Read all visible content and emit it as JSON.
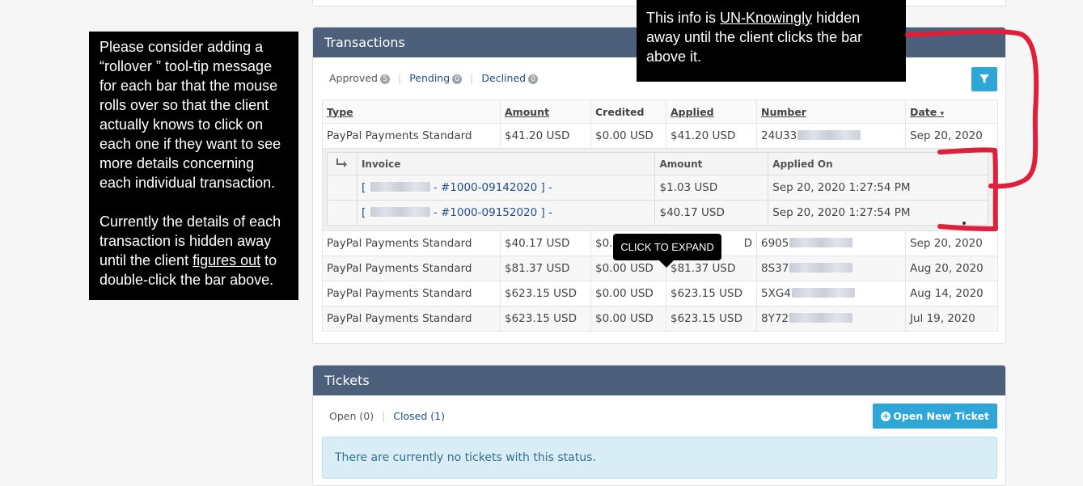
{
  "transactions": {
    "title": "Transactions",
    "filters": [
      {
        "label": "Approved",
        "count": "5"
      },
      {
        "label": "Pending",
        "count": "0"
      },
      {
        "label": "Declined",
        "count": "0"
      }
    ],
    "filter_button_icon": "filter-icon",
    "columns": [
      "Type",
      "Amount",
      "Credited",
      "Applied",
      "Number",
      "Date"
    ],
    "sort_caret": "▾",
    "rows": [
      {
        "type": "PayPal Payments Standard",
        "amount": "$41.20 USD",
        "credited": "$0.00 USD",
        "applied": "$41.20 USD",
        "number": "24U33",
        "date": "Sep 20, 2020"
      },
      {
        "type": "PayPal Payments Standard",
        "amount": "$40.17 USD",
        "credited": "$0.0",
        "applied": "D",
        "number": "6905",
        "date": "Sep 20, 2020"
      },
      {
        "type": "PayPal Payments Standard",
        "amount": "$81.37 USD",
        "credited": "$0.00 USD",
        "applied": "$81.37 USD",
        "number": "8S37",
        "date": "Aug 20, 2020"
      },
      {
        "type": "PayPal Payments Standard",
        "amount": "$623.15 USD",
        "credited": "$0.00 USD",
        "applied": "$623.15 USD",
        "number": "5XG4",
        "date": "Aug 14, 2020"
      },
      {
        "type": "PayPal Payments Standard",
        "amount": "$623.15 USD",
        "credited": "$0.00 USD",
        "applied": "$623.15 USD",
        "number": "8Y72",
        "date": "Jul 19, 2020"
      }
    ],
    "detail": {
      "arrow_icon": "reply-arrow-icon",
      "columns": [
        "Invoice",
        "Amount",
        "Applied On"
      ],
      "rows": [
        {
          "open": "[",
          "invoice": "- #1000-09142020 ] -",
          "amount": "$1.03 USD",
          "applied_on": "Sep 20, 2020 1:27:54 PM"
        },
        {
          "open": "[",
          "invoice": "- #1000-09152020 ] -",
          "amount": "$40.17 USD",
          "applied_on": "Sep 20, 2020 1:27:54 PM"
        }
      ]
    }
  },
  "tickets": {
    "title": "Tickets",
    "filters": [
      {
        "label": "Open (0)"
      },
      {
        "label": "Closed (1)"
      }
    ],
    "open_button": "Open New Ticket",
    "notice": "There are currently no tickets with this status."
  },
  "annotations": {
    "left_note_p1": "Please consider adding a “rollover ” tool-tip message for each bar that the mouse rolls over so that the client actually knows to click on each one if they want to see more details concerning each individual transaction.",
    "left_note_p2_a": "Currently the details of each transaction is hidden away until the client ",
    "left_note_p2_u": "figures out",
    "left_note_p2_b": " to double-click the bar above.",
    "top_note_a": "This info is ",
    "top_note_u": "UN-Knowingly",
    "top_note_b": " hidden away until the client clicks the bar above it.",
    "tooltip": "CLICK TO EXPAND",
    "bracket_color": "#e0203a"
  }
}
